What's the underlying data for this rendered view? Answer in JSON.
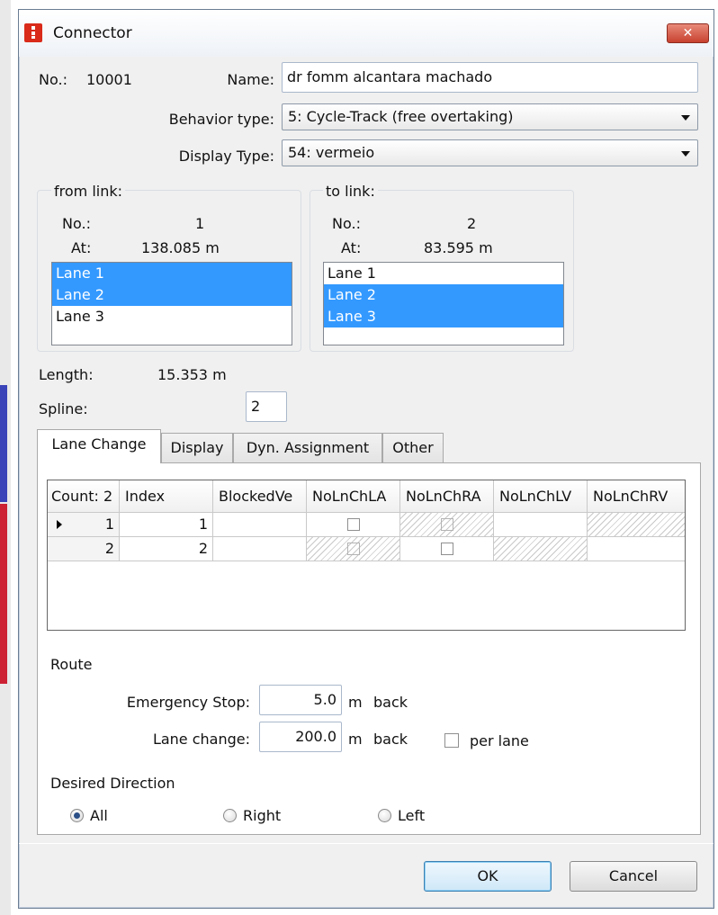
{
  "window": {
    "title": "Connector",
    "close_label": "✕"
  },
  "header": {
    "no_label": "No.:",
    "no_value": "10001",
    "name_label": "Name:",
    "name_value": "dr fomm alcantara machado",
    "behavior_label": "Behavior type:",
    "behavior_value": "5: Cycle-Track (free overtaking)",
    "display_label": "Display Type:",
    "display_value": "54: vermeio"
  },
  "from_link": {
    "title": "from link:",
    "no_label": "No.:",
    "no_value": "1",
    "at_label": "At:",
    "at_value": "138.085 m",
    "lanes": [
      {
        "label": "Lane 1",
        "selected": true
      },
      {
        "label": "Lane 2",
        "selected": true
      },
      {
        "label": "Lane 3",
        "selected": false
      }
    ]
  },
  "to_link": {
    "title": "to link:",
    "no_label": "No.:",
    "no_value": "2",
    "at_label": "At:",
    "at_value": "83.595 m",
    "lanes": [
      {
        "label": "Lane 1",
        "selected": false
      },
      {
        "label": "Lane 2",
        "selected": true
      },
      {
        "label": "Lane 3",
        "selected": true
      }
    ]
  },
  "geometry": {
    "length_label": "Length:",
    "length_value": "15.353 m",
    "spline_label": "Spline:",
    "spline_value": "2"
  },
  "tabs": [
    {
      "label": "Lane Change",
      "active": true
    },
    {
      "label": "Display",
      "active": false
    },
    {
      "label": "Dyn. Assignment",
      "active": false
    },
    {
      "label": "Other",
      "active": false
    }
  ],
  "grid": {
    "columns": [
      "Count: 2",
      "Index",
      "BlockedVe",
      "NoLnChLA",
      "NoLnChRA",
      "NoLnChLV",
      "NoLnChRV"
    ],
    "rows": [
      {
        "row": "1",
        "index": "1",
        "current": true
      },
      {
        "row": "2",
        "index": "2",
        "current": false
      }
    ]
  },
  "route": {
    "title": "Route",
    "emergency_label": "Emergency Stop:",
    "emergency_value": "5.0",
    "lane_change_label": "Lane change:",
    "lane_change_value": "200.0",
    "unit": "m",
    "back": "back",
    "per_lane_label": "per lane",
    "per_lane_checked": false
  },
  "direction": {
    "title": "Desired Direction",
    "options": [
      {
        "label": "All",
        "selected": true
      },
      {
        "label": "Right",
        "selected": false
      },
      {
        "label": "Left",
        "selected": false
      }
    ]
  },
  "buttons": {
    "ok": "OK",
    "cancel": "Cancel"
  },
  "colors": {
    "selection": "#3399ff",
    "close_button": "#c8412f",
    "app_icon": "#d92a1a"
  }
}
